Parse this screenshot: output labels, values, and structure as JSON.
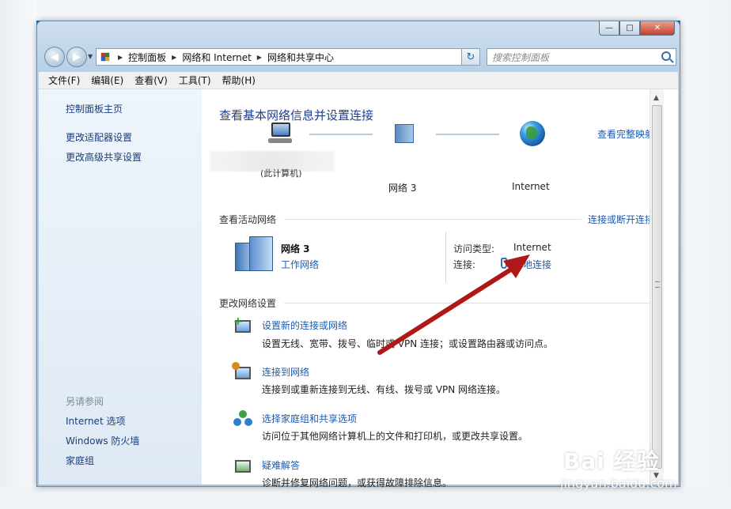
{
  "window": {
    "minimize": "—",
    "maximize": "□",
    "close": "✕"
  },
  "address": {
    "crumbs": [
      "控制面板",
      "网络和 Internet",
      "网络和共享中心"
    ],
    "search_placeholder": "搜索控制面板"
  },
  "menu": [
    "文件(F)",
    "编辑(E)",
    "查看(V)",
    "工具(T)",
    "帮助(H)"
  ],
  "sidebar": {
    "home": "控制面板主页",
    "links": [
      "更改适配器设置",
      "更改高级共享设置"
    ],
    "see_also_title": "另请参阅",
    "see_also": [
      "Internet 选项",
      "Windows 防火墙",
      "家庭组"
    ]
  },
  "main": {
    "heading": "查看基本网络信息并设置连接",
    "view_full_map": "查看完整映射",
    "map": {
      "computer_label": "(此计算机)",
      "network_label": "网络  3",
      "internet_label": "Internet"
    },
    "active_section": "查看活动网络",
    "connect_disconnect": "连接或断开连接",
    "active_network": {
      "name": "网络  3",
      "type": "工作网络",
      "access_label": "访问类型:",
      "access_value": "Internet",
      "conn_label": "连接:",
      "conn_value": "本地连接"
    },
    "change_section": "更改网络设置",
    "tasks": [
      {
        "title": "设置新的连接或网络",
        "desc": "设置无线、宽带、拨号、临时或 VPN 连接；或设置路由器或访问点。"
      },
      {
        "title": "连接到网络",
        "desc": "连接到或重新连接到无线、有线、拨号或 VPN 网络连接。"
      },
      {
        "title": "选择家庭组和共享选项",
        "desc": "访问位于其他网络计算机上的文件和打印机，或更改共享设置。"
      },
      {
        "title": "疑难解答",
        "desc": "诊断并修复网络问题，或获得故障排除信息。"
      }
    ]
  },
  "watermark": {
    "brand": "Bai  经验",
    "url": "jingyan.baidu.com"
  },
  "colors": {
    "link": "#1c5bb0",
    "heading": "#1f3f8f",
    "arrow": "#b01818"
  }
}
